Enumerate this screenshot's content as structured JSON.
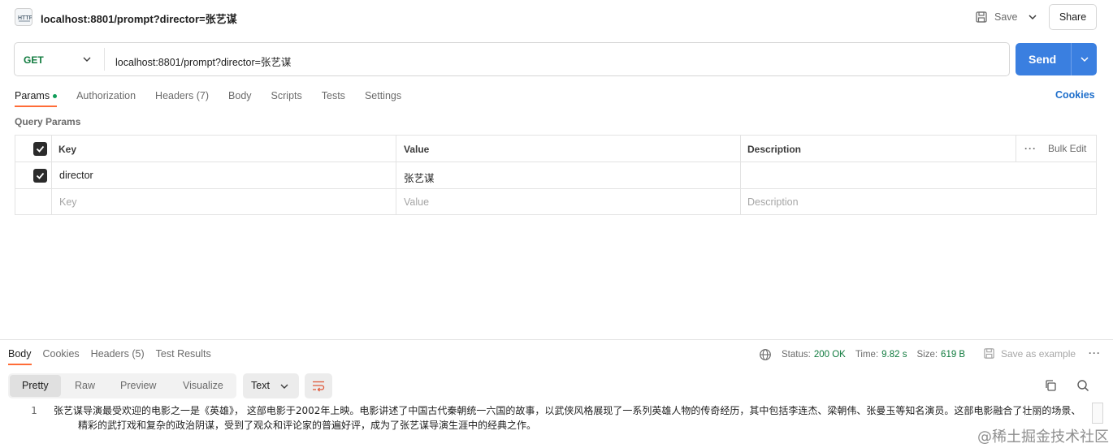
{
  "tab": {
    "title": "localhost:8801/prompt?director=张艺谋",
    "icon": "http-file-icon"
  },
  "toolbar": {
    "save_label": "Save",
    "share_label": "Share"
  },
  "request": {
    "method": "GET",
    "url": "localhost:8801/prompt?director=张艺谋",
    "send_label": "Send"
  },
  "request_tabs": {
    "items": [
      {
        "label": "Params"
      },
      {
        "label": "Authorization"
      },
      {
        "label": "Headers (7)"
      },
      {
        "label": "Body"
      },
      {
        "label": "Scripts"
      },
      {
        "label": "Tests"
      },
      {
        "label": "Settings"
      }
    ],
    "cookies_label": "Cookies"
  },
  "query_params": {
    "section_label": "Query Params",
    "headers": {
      "key": "Key",
      "value": "Value",
      "description": "Description",
      "bulk_edit": "Bulk Edit"
    },
    "rows": [
      {
        "checked": true,
        "key": "director",
        "value": "张艺谋",
        "description": ""
      }
    ],
    "placeholder": {
      "key": "Key",
      "value": "Value",
      "description": "Description"
    }
  },
  "response": {
    "tabs": [
      {
        "label": "Body"
      },
      {
        "label": "Cookies"
      },
      {
        "label": "Headers (5)"
      },
      {
        "label": "Test Results"
      }
    ],
    "status_label": "Status:",
    "status_value": "200 OK",
    "time_label": "Time:",
    "time_value": "9.82 s",
    "size_label": "Size:",
    "size_value": "619 B",
    "save_example_label": "Save as example",
    "view_modes": [
      "Pretty",
      "Raw",
      "Preview",
      "Visualize"
    ],
    "active_view": "Pretty",
    "format": "Text",
    "line_number": "1",
    "body_line1": "张艺谋导演最受欢迎的电影之一是《英雄》， 这部电影于2002年上映。电影讲述了中国古代秦朝统一六国的故事，以武侠风格展现了一系列英雄人物的传奇经历，其中包括李连杰、梁朝伟、张曼玉等知名演员。这部电影融合了壮丽的场景、",
    "body_line2": "精彩的武打戏和复杂的政治阴谋，受到了观众和评论家的普遍好评，成为了张艺谋导演生涯中的经典之作。"
  },
  "watermark": "@稀土掘金技术社区",
  "colors": {
    "send": "#3a7fe0",
    "active_tab_underline": "#ff6c37",
    "method_get": "#0f7a3d",
    "link": "#1f6fcb"
  }
}
